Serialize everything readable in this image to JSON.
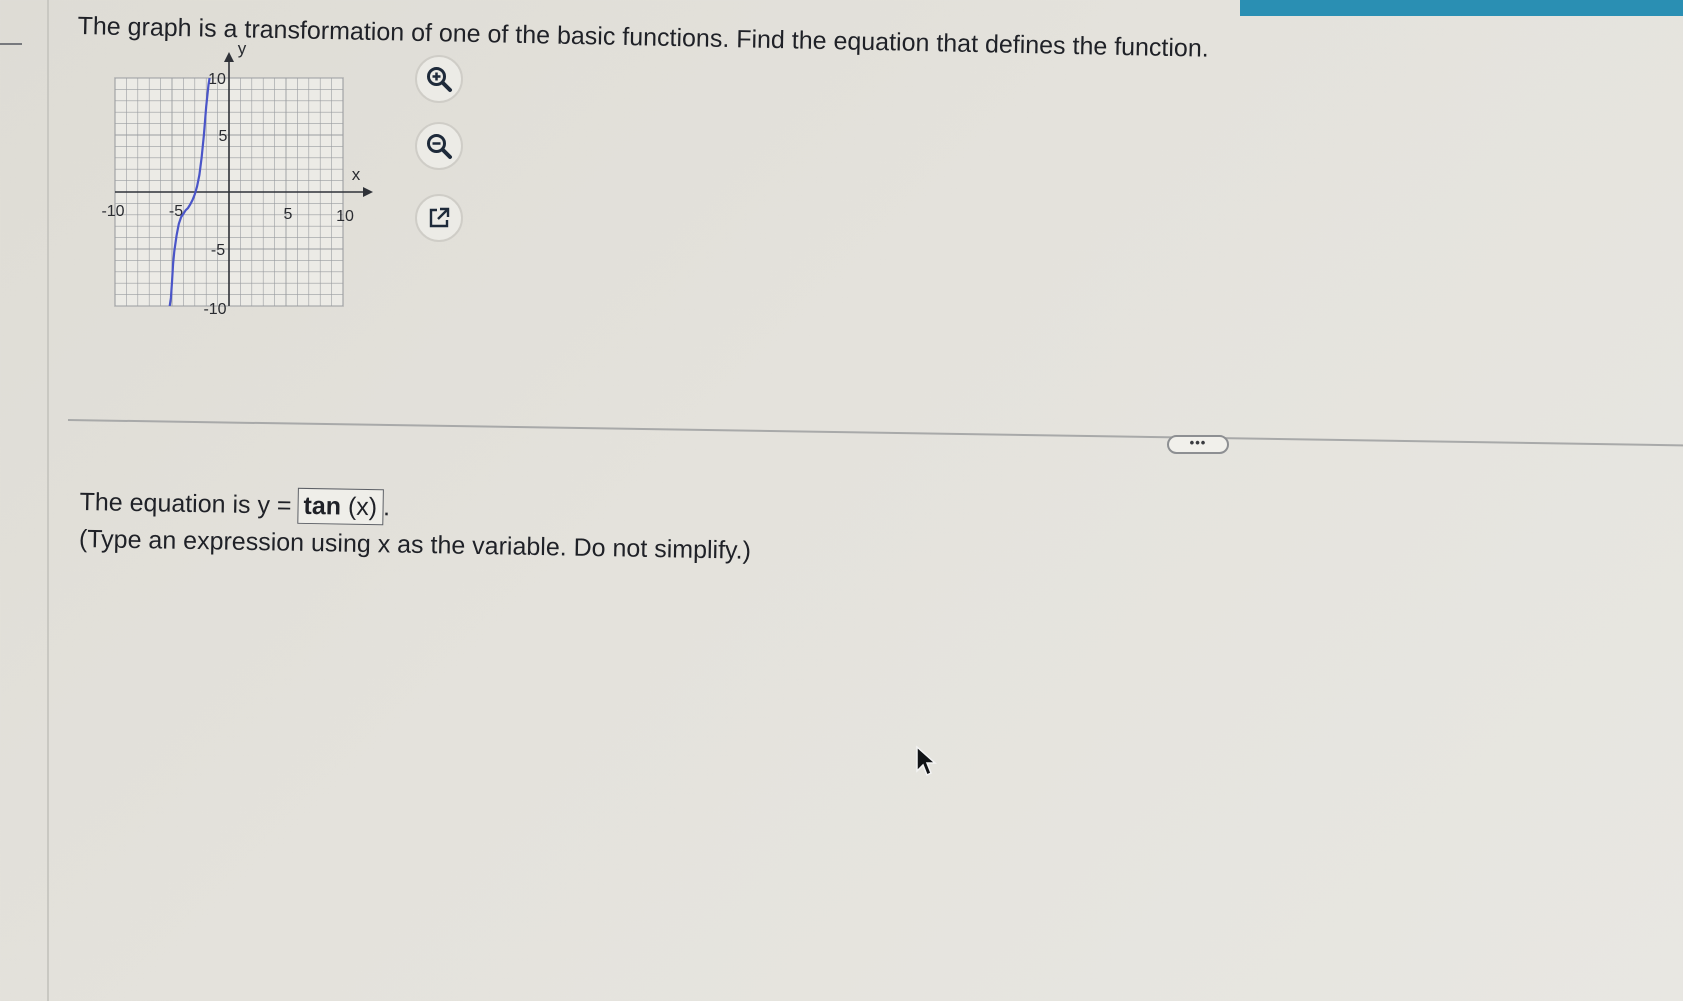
{
  "question": {
    "text": "The graph is a transformation of one of the basic functions. Find the equation that defines the function."
  },
  "graph": {
    "x_axis_label": "x",
    "y_axis_label": "y",
    "x_range": [
      -10,
      10
    ],
    "y_range": [
      -10,
      10
    ],
    "x_tick_labels": [
      "-10",
      "-5",
      "5",
      "10"
    ],
    "y_tick_labels": [
      "10",
      "5",
      "-5",
      "-10"
    ],
    "curve_color": "#4a55c8"
  },
  "chart_data": {
    "type": "line",
    "title": "",
    "xlabel": "x",
    "ylabel": "y",
    "xlim": [
      -10,
      10
    ],
    "ylim": [
      -10,
      10
    ],
    "grid": true,
    "series": [
      {
        "x": [
          -5.2,
          -5.1,
          -5.0,
          -4.9,
          -4.8,
          -4.6,
          -4.4,
          -4.2,
          -4.0,
          -3.8,
          -3.6,
          -3.4,
          -3.2,
          -3.0,
          -2.8,
          -2.6,
          -2.4,
          -2.2,
          -2.0,
          -1.8,
          -1.7
        ],
        "y": [
          -10.0,
          -9.3,
          -7.9,
          -6.3,
          -5.2,
          -3.8,
          -2.8,
          -2.2,
          -1.9,
          -1.6,
          -1.4,
          -1.1,
          -0.7,
          -0.2,
          0.5,
          1.5,
          3.0,
          5.0,
          7.5,
          9.4,
          10.0
        ]
      }
    ]
  },
  "tools": {
    "zoom_in": "zoom-in-icon",
    "zoom_out": "zoom-out-icon",
    "popout": "external-link-icon"
  },
  "more_button": {
    "label": "•••"
  },
  "answer": {
    "prefix": "The equation is y =",
    "fn": "tan",
    "arg": "(x)",
    "suffix": ".",
    "hint": "(Type an expression using x as the variable. Do not simplify.)"
  },
  "colors": {
    "accent": "#2a8fb3",
    "curve": "#4a55c8"
  }
}
